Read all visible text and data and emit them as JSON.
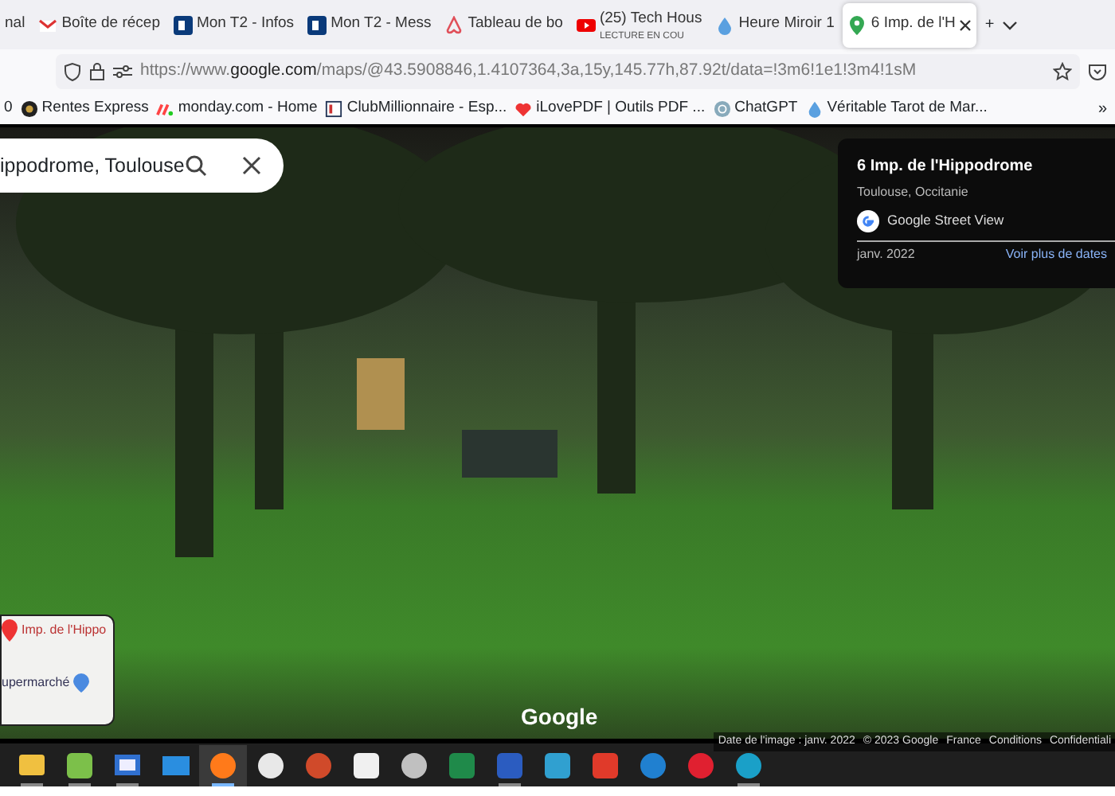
{
  "tabs": [
    {
      "title": "nal",
      "selected": false
    },
    {
      "title": "Boîte de récep",
      "kind": "mail",
      "selected": false
    },
    {
      "title": "Mon T2 - Infos",
      "kind": "b",
      "selected": false
    },
    {
      "title": "Mon T2 - Mess",
      "kind": "b",
      "selected": false
    },
    {
      "title": "Tableau de bo",
      "kind": "airbnb",
      "selected": false
    },
    {
      "title": "(25) Tech Hous",
      "subtitle": "LECTURE EN COU",
      "kind": "youtube",
      "selected": false
    },
    {
      "title": "Heure Miroir 1",
      "kind": "drop",
      "selected": false
    },
    {
      "title": "6 Imp. de l'H",
      "kind": "pin",
      "selected": true
    }
  ],
  "new_tab": "+",
  "url": {
    "prefix": "https://www.",
    "domain": "google.com",
    "rest": "/maps/@43.5908846,1.4107364,3a,15y,145.77h,87.92t/data=!3m6!1e1!3m4!1sM"
  },
  "bookmarks": [
    {
      "label": "0"
    },
    {
      "label": "Rentes Express",
      "kind": "coin"
    },
    {
      "label": "monday.com - Home",
      "kind": "monday"
    },
    {
      "label": "ClubMillionnaire - Esp...",
      "kind": "club"
    },
    {
      "label": "iLovePDF | Outils PDF ...",
      "kind": "heart"
    },
    {
      "label": "ChatGPT",
      "kind": "gpt"
    },
    {
      "label": "Véritable Tarot de Mar...",
      "kind": "drop"
    }
  ],
  "bookmarks_more": "»",
  "search": {
    "value": "ippodrome, Toulouse"
  },
  "info_card": {
    "title": "6 Imp. de l'Hippodrome",
    "subtitle": "Toulouse, Occitanie",
    "source": "Google Street View",
    "date": "janv. 2022",
    "link": "Voir plus de dates"
  },
  "minimap": {
    "place": "Imp. de l'Hippo",
    "poi": "upermarché"
  },
  "logo": "Google",
  "footer": [
    "Date de l'image : janv. 2022",
    "© 2023 Google",
    "France",
    "Conditions",
    "Confidentiali"
  ],
  "taskbar": [
    {
      "kind": "folder",
      "color": "#f0c040",
      "open": true,
      "selected": false
    },
    {
      "kind": "square",
      "color": "#7cc04a",
      "open": true,
      "selected": false
    },
    {
      "kind": "monitor",
      "color": "#3070d0",
      "open": true,
      "selected": false
    },
    {
      "kind": "mail",
      "color": "#2a8ee0",
      "open": false,
      "selected": false
    },
    {
      "kind": "circle",
      "color": "#ff7a1a",
      "open": true,
      "selected": true
    },
    {
      "kind": "circle",
      "color": "#e8e8e8",
      "open": false,
      "selected": false
    },
    {
      "kind": "circle",
      "color": "#d04a2a",
      "open": false,
      "selected": false
    },
    {
      "kind": "square",
      "color": "#f0f0f0",
      "open": false,
      "selected": false
    },
    {
      "kind": "circle",
      "color": "#c0c0c0",
      "open": false,
      "selected": false
    },
    {
      "kind": "square",
      "color": "#1f8a4a",
      "open": false,
      "selected": false
    },
    {
      "kind": "square",
      "color": "#2b5cc0",
      "open": true,
      "selected": false
    },
    {
      "kind": "square",
      "color": "#30a0d0",
      "open": false,
      "selected": false
    },
    {
      "kind": "square",
      "color": "#e03a2a",
      "open": false,
      "selected": false
    },
    {
      "kind": "circle",
      "color": "#2080d0",
      "open": false,
      "selected": false
    },
    {
      "kind": "circle",
      "color": "#e02030",
      "open": false,
      "selected": false
    },
    {
      "kind": "circle",
      "color": "#1aa0c8",
      "open": true,
      "selected": false
    }
  ]
}
